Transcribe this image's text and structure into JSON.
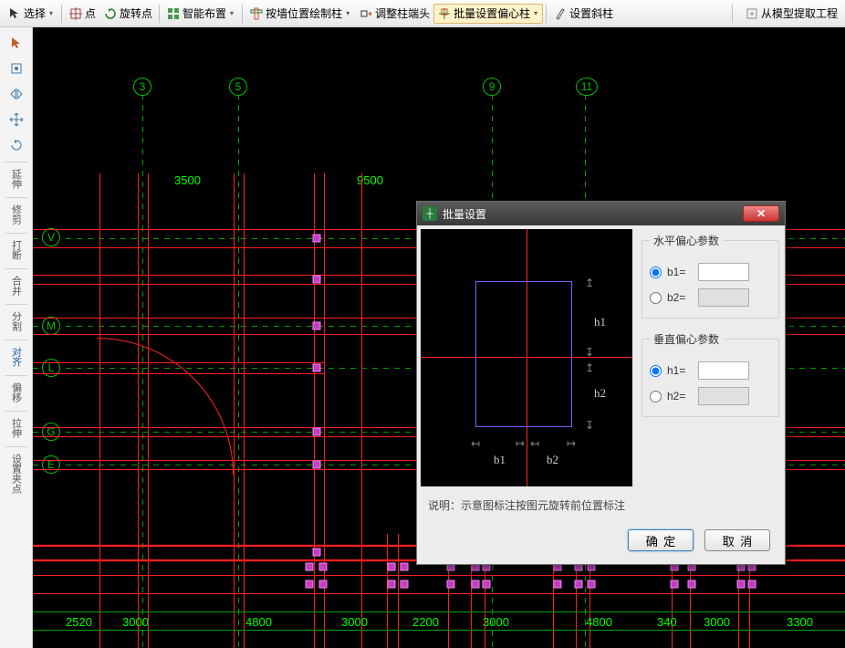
{
  "toolbar": {
    "select": "选择",
    "point": "点",
    "rotate_point": "旋转点",
    "smart_place": "智能布置",
    "draw_by_wall": "按墙位置绘制柱",
    "adjust_end": "调整柱端头",
    "batch_offset": "批量设置偏心柱",
    "set_slant": "设置斜柱",
    "extract_model": "从模型提取工程"
  },
  "left_tools": {
    "extend": "延伸",
    "trim": "修剪",
    "break": "打断",
    "merge": "合并",
    "split": "分割",
    "align": "对齐",
    "offset": "偏移",
    "stretch": "拉伸",
    "set_grip": "设置夹点"
  },
  "axes_top": [
    "3",
    "5",
    "9",
    "11"
  ],
  "axes_left": [
    "V",
    "M",
    "L",
    "G",
    "E"
  ],
  "dims_top": [
    "3500",
    "9500"
  ],
  "dims_bottom": [
    "2520",
    "3000",
    "4800",
    "3000",
    "2200",
    "3000",
    "4800",
    "340",
    "3000",
    "3300"
  ],
  "dialog": {
    "title": "批量设置",
    "group_h": "水平偏心参数",
    "group_v": "垂直偏心参数",
    "b1": "b1=",
    "b2": "b2=",
    "h1": "h1=",
    "h2": "h2=",
    "note": "说明：示意图标注按图元旋转前位置标注",
    "ok": "确定",
    "cancel": "取消",
    "pv_b1": "b1",
    "pv_b2": "b2",
    "pv_h1": "h1",
    "pv_h2": "h2"
  }
}
